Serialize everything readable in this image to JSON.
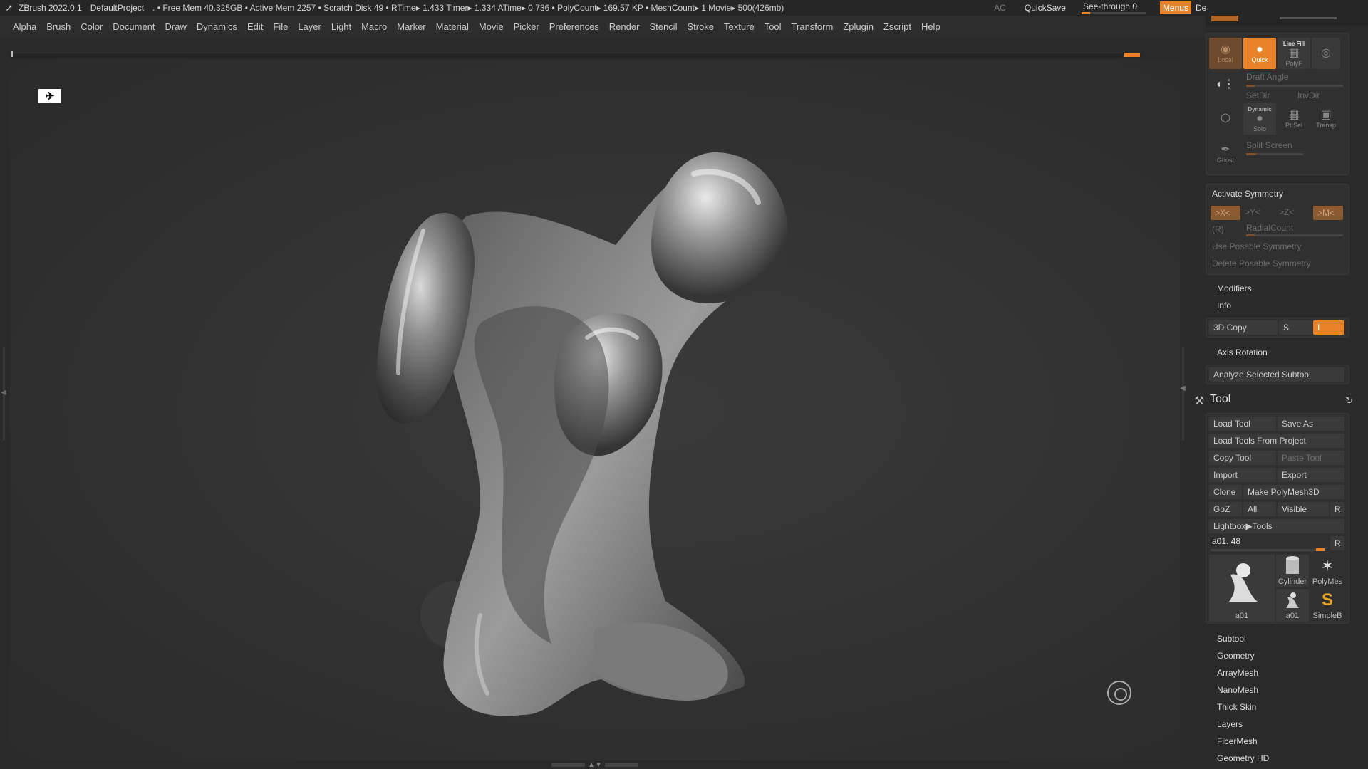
{
  "titlebar": {
    "app": "ZBrush 2022.0.1",
    "project": "DefaultProject",
    "status": ". • Free Mem 40.325GB • Active Mem 2257 • Scratch Disk 49 •  RTime▸ 1.433 Timer▸ 1.334 ATime▸ 0.736 • PolyCount▸ 169.57 KP  • MeshCount▸ 1  Movie▸ 500(426mb)",
    "ac": "AC",
    "quicksave": "QuickSave",
    "see_through": "See-through   0",
    "menus": "Menus",
    "default_zscript": "DefaultZScript"
  },
  "menubar": [
    "Alpha",
    "Brush",
    "Color",
    "Document",
    "Draw",
    "Dynamics",
    "Edit",
    "File",
    "Layer",
    "Light",
    "Macro",
    "Marker",
    "Material",
    "Movie",
    "Picker",
    "Preferences",
    "Render",
    "Stencil",
    "Stroke",
    "Texture",
    "Tool",
    "Transform",
    "Zplugin",
    "Zscript",
    "Help"
  ],
  "colors": {
    "accent": "#e8832a",
    "panel": "#303030",
    "button": "#3a3a3a",
    "text": "#c8c8c8"
  },
  "view_panel": {
    "local": "Local",
    "quick": "Quick",
    "line_fill": "Line Fill",
    "polyf": "PolyF",
    "draft_angle": "Draft Angle",
    "setdir": "SetDir",
    "invdir": "InvDir",
    "dynamic": "Dynamic",
    "solo": "Solo",
    "pt_sel": "Pt Sel",
    "transp": "Transp",
    "ghost": "Ghost",
    "split_screen": "Split Screen"
  },
  "symmetry": {
    "activate": "Activate Symmetry",
    "x": ">X<",
    "y": ">Y<",
    "z": ">Z<",
    "m": ">M<",
    "r": "(R)",
    "radial_count": "RadialCount",
    "use_posable": "Use Posable Symmetry",
    "delete_posable": "Delete Posable Symmetry"
  },
  "transform_more": {
    "modifiers": "Modifiers",
    "info": "Info",
    "copy3d": "3D Copy",
    "s": "S",
    "i": "I",
    "axis_rotation": "Axis Rotation",
    "analyze": "Analyze Selected Subtool"
  },
  "tool": {
    "title": "Tool",
    "load_tool": "Load Tool",
    "save_as": "Save As",
    "load_from_project": "Load Tools From Project",
    "copy_tool": "Copy Tool",
    "paste_tool": "Paste Tool",
    "import": "Import",
    "export": "Export",
    "clone": "Clone",
    "make_polymesh": "Make PolyMesh3D",
    "goz": "GoZ",
    "all": "All",
    "visible": "Visible",
    "r": "R",
    "lightbox": "Lightbox▶Tools",
    "current": "a01. 48",
    "current_r": "R",
    "thumbs": [
      "a01",
      "Cylinder",
      "PolyMes",
      "a01",
      "SimpleB"
    ]
  },
  "tool_sections": [
    "Subtool",
    "Geometry",
    "ArrayMesh",
    "NanoMesh",
    "Thick Skin",
    "Layers",
    "FiberMesh",
    "Geometry HD"
  ]
}
